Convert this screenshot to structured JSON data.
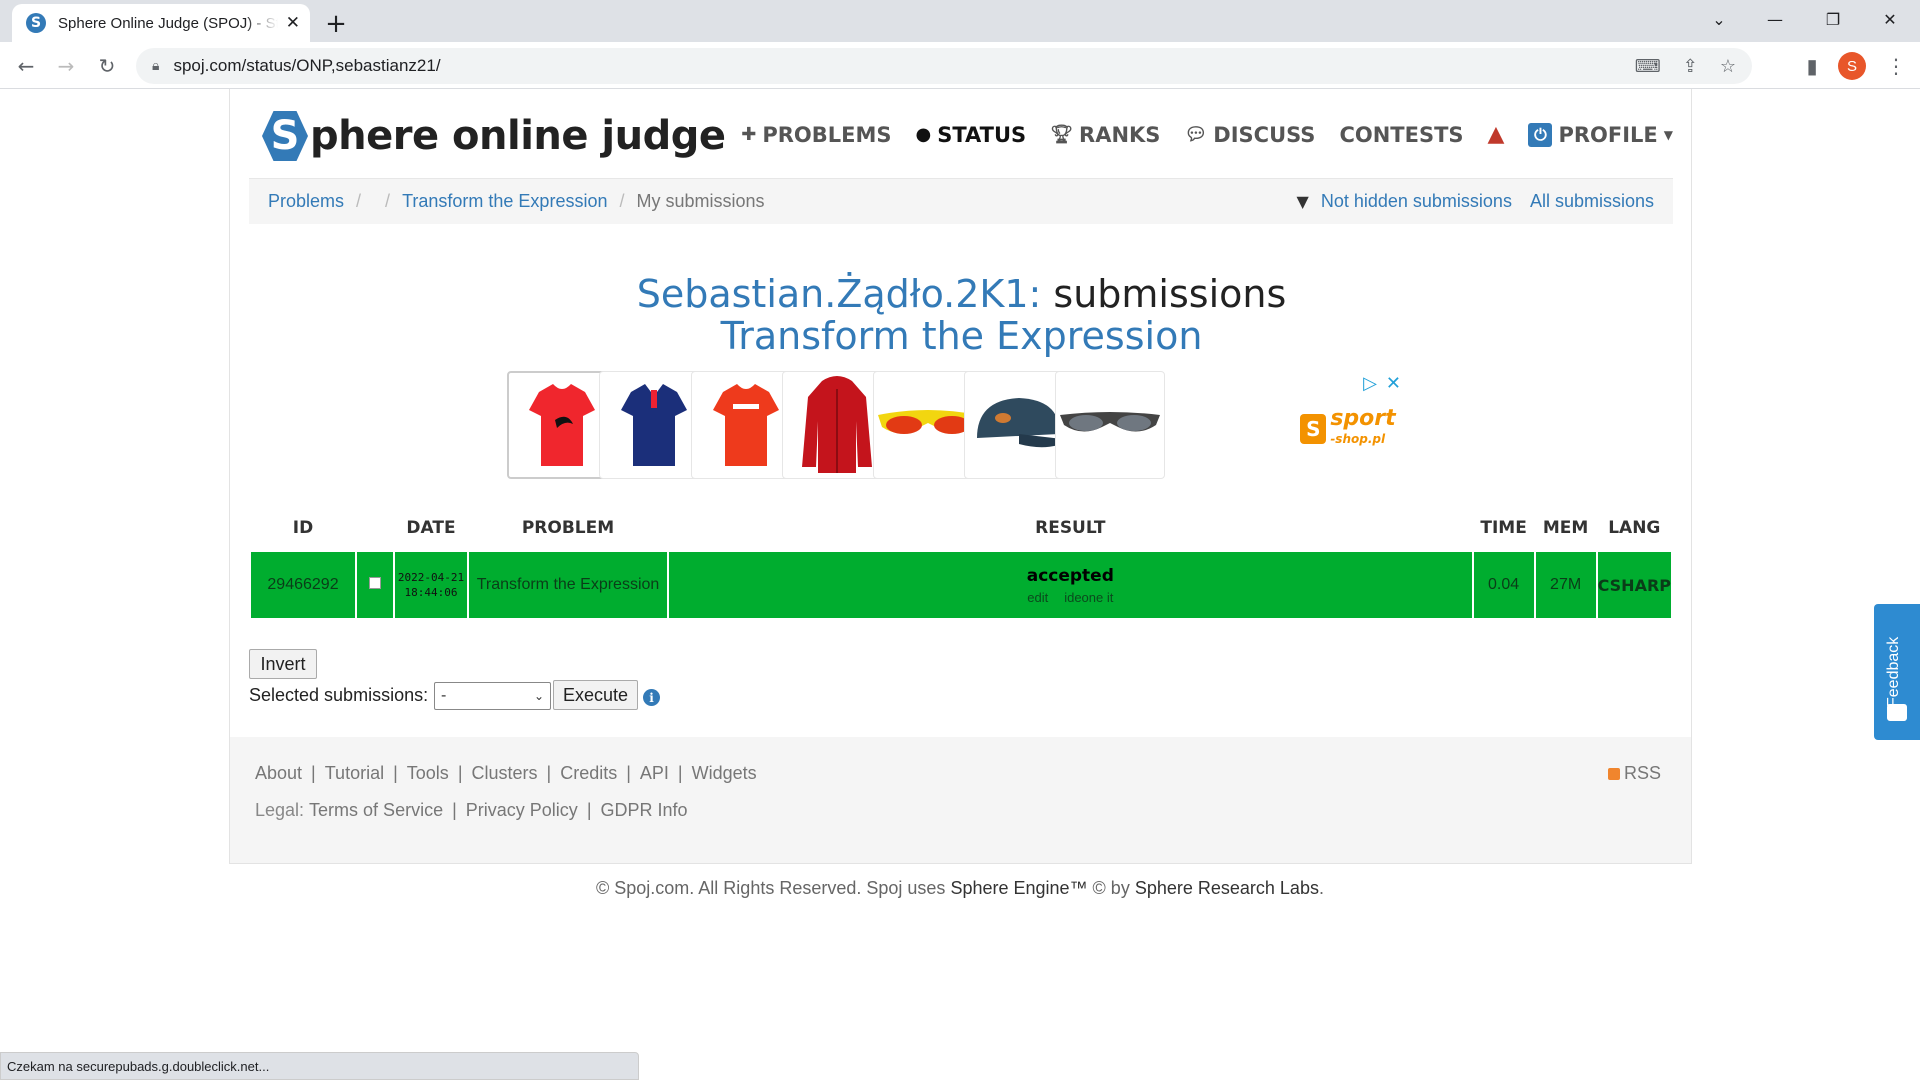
{
  "browser": {
    "tab_title": "Sphere Online Judge (SPOJ) - Status",
    "favicon_letter": "S",
    "url": "spoj.com/status/ONP,sebastianz21/",
    "profile_initial": "S",
    "status_text": "Czekam na securepubads.g.doubleclick.net..."
  },
  "site": {
    "logo_letter": "S",
    "logo_text": "phere online judge",
    "nav": [
      {
        "label": "PROBLEMS",
        "icon": "puzzle-icon"
      },
      {
        "label": "STATUS",
        "icon": "circle-icon",
        "active": true
      },
      {
        "label": "RANKS",
        "icon": "trophy-icon"
      },
      {
        "label": "DISCUSS",
        "icon": "chat-icon"
      },
      {
        "label": "CONTESTS",
        "icon": ""
      },
      {
        "label": "PROFILE",
        "icon": "power-icon"
      }
    ]
  },
  "breadcrumb": {
    "items": [
      "Problems",
      "Transform the Expression",
      "My submissions"
    ],
    "not_hidden": "Not hidden submissions",
    "all": "All submissions"
  },
  "heading": {
    "user": "Sebastian.Żądło.2K1:",
    "suffix": "submissions",
    "problem": "Transform the Expression"
  },
  "table": {
    "headers": [
      "ID",
      "DATE",
      "PROBLEM",
      "RESULT",
      "TIME",
      "MEM",
      "LANG"
    ],
    "rows": [
      {
        "id": "29466292",
        "date": "2022-04-21",
        "time_of_day": "18:44:06",
        "problem": "Transform the Expression",
        "result": "accepted",
        "edit": "edit",
        "ideone": "ideone it",
        "time": "0.04",
        "mem": "27M",
        "lang": "CSHARP"
      }
    ]
  },
  "controls": {
    "invert": "Invert",
    "selected_label": "Selected submissions:",
    "select_value": "-",
    "execute": "Execute"
  },
  "footer": {
    "links": [
      "About",
      "Tutorial",
      "Tools",
      "Clusters",
      "Credits",
      "API",
      "Widgets"
    ],
    "legal_label": "Legal:",
    "legal_links": [
      "Terms of Service",
      "Privacy Policy",
      "GDPR Info"
    ],
    "rss": "RSS",
    "copyright_pre": "© Spoj.com. All Rights Reserved. Spoj uses",
    "engine": "Sphere Engine™",
    "copyright_mid": "© by",
    "labs": "Sphere Research Labs",
    "copyright_end": "."
  },
  "feedback": "Feedback",
  "ad": {
    "brand": "sport",
    "brand_sub": "-shop.pl"
  },
  "colors": {
    "accent": "#337ab7",
    "accepted": "#00ad2f"
  }
}
